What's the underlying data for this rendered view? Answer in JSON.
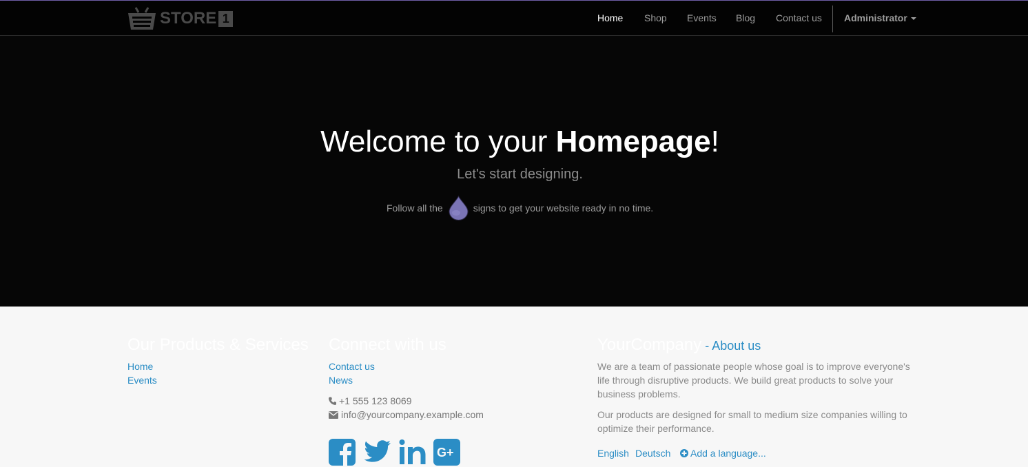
{
  "brand": {
    "name": "STORE",
    "badge": "1"
  },
  "nav": {
    "items": [
      {
        "label": "Home",
        "active": true
      },
      {
        "label": "Shop",
        "active": false
      },
      {
        "label": "Events",
        "active": false
      },
      {
        "label": "Blog",
        "active": false
      },
      {
        "label": "Contact us",
        "active": false
      }
    ],
    "user_label": "Administrator"
  },
  "hero": {
    "title_prefix": "Welcome to your ",
    "title_bold": "Homepage",
    "title_suffix": "!",
    "subtitle": "Let's start designing.",
    "follow_before": "Follow all the",
    "follow_after": "signs to get your website ready in no time."
  },
  "footer": {
    "products": {
      "heading": "Our Products & Services",
      "links": [
        "Home",
        "Events"
      ]
    },
    "connect": {
      "heading": "Connect with us",
      "links": [
        "Contact us",
        "News"
      ],
      "phone": "+1 555 123 8069",
      "email": "info@yourcompany.example.com",
      "social": [
        "facebook",
        "twitter",
        "linkedin",
        "google-plus"
      ]
    },
    "about": {
      "company": "YourCompany",
      "separator": " - ",
      "about_link": "About us",
      "paragraph1": "We are a team of passionate people whose goal is to improve everyone's life through disruptive products. We build great products to solve your business problems.",
      "paragraph2": "Our products are designed for small to medium size companies willing to optimize their performance."
    },
    "languages": [
      "English",
      "Deutsch"
    ],
    "add_language": "Add a language..."
  },
  "colors": {
    "nav_bg": "#030303",
    "hero_bg": "#060606",
    "footer_bg": "#f7f7f7",
    "link": "#2b8dc5",
    "drop": "#7a74b5"
  }
}
